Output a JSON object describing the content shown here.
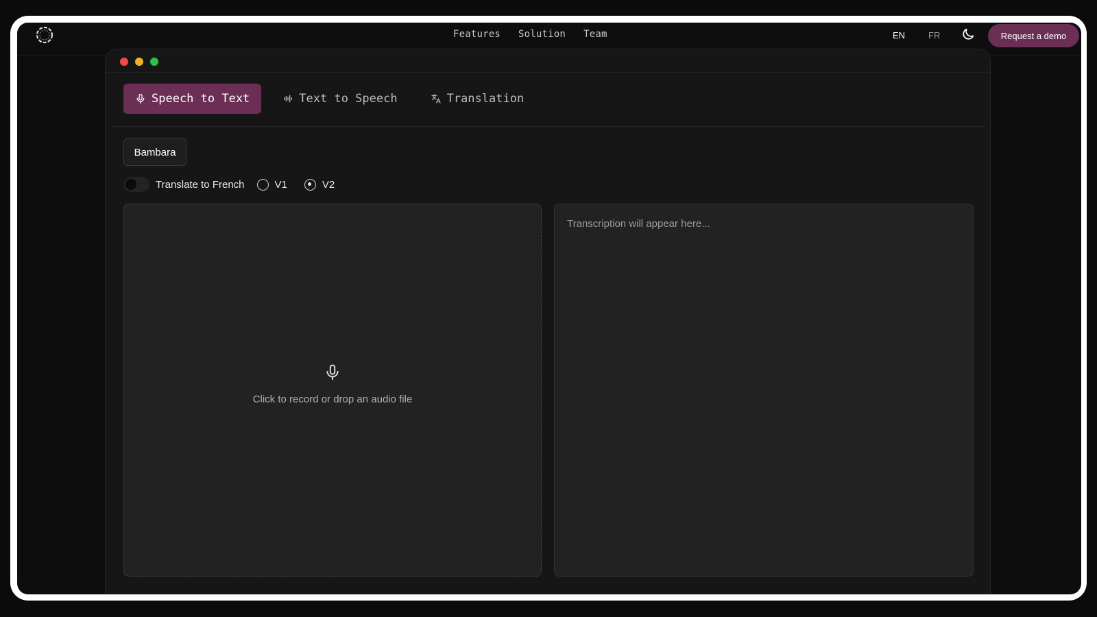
{
  "nav": {
    "links": [
      "Features",
      "Solution",
      "Team"
    ],
    "lang_en": "EN",
    "lang_fr": "FR",
    "demo_button": "Request a demo"
  },
  "app": {
    "tabs": [
      {
        "label": "Speech to Text",
        "icon": "mic-icon",
        "active": true
      },
      {
        "label": "Text to Speech",
        "icon": "audio-wave-icon",
        "active": false
      },
      {
        "label": "Translation",
        "icon": "translate-icon",
        "active": false
      }
    ],
    "source_language": "Bambara",
    "translate_toggle": {
      "label": "Translate to French",
      "on": false
    },
    "model_versions": [
      {
        "label": "V1",
        "selected": false
      },
      {
        "label": "V2",
        "selected": true
      }
    ],
    "drop_zone_hint": "Click to record or drop an audio file",
    "transcription_placeholder": "Transcription will appear here..."
  },
  "colors": {
    "accent": "#6b2f55",
    "background": "#0d0d0e",
    "panel": "#222223"
  }
}
